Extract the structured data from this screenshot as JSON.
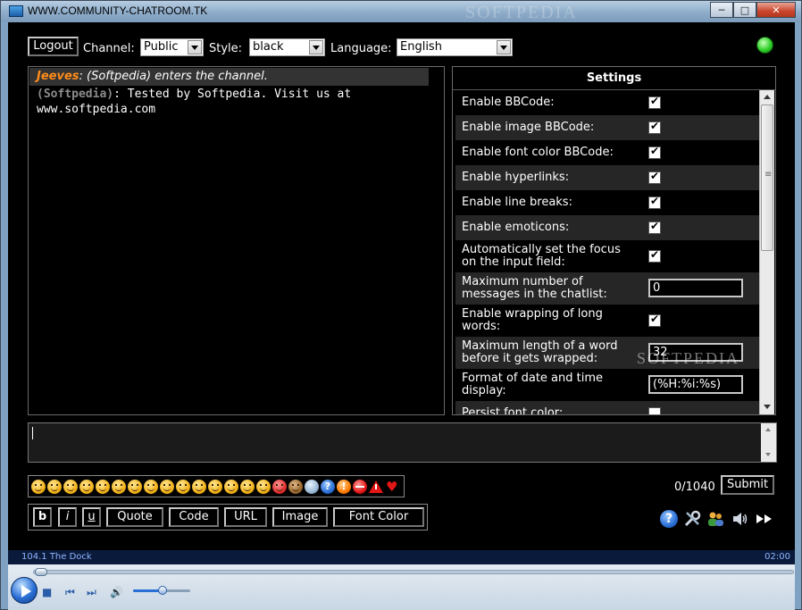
{
  "window": {
    "title": "WWW.COMMUNITY-CHATROOM.TK",
    "watermark": "SOFTPEDIA",
    "minimize": "─",
    "maximize": "□",
    "close": "✕"
  },
  "topbar": {
    "logout_label": "Logout",
    "channel_label": "Channel:",
    "channel_value": "Public",
    "style_label": "Style:",
    "style_value": "black",
    "language_label": "Language:",
    "language_value": "English",
    "status_color": "#2fd02a"
  },
  "chat": {
    "messages": [
      {
        "user": "Jeeves",
        "sep": ": ",
        "text": "(Softpedia) enters the channel."
      },
      {
        "user": "(Softpedia)",
        "sep": ": ",
        "text": "Tested by Softpedia. Visit us at www.softpedia.com"
      }
    ]
  },
  "settings": {
    "title": "Settings",
    "rows": [
      {
        "label": "Enable BBCode:",
        "type": "checkbox",
        "checked": true
      },
      {
        "label": "Enable image BBCode:",
        "type": "checkbox",
        "checked": true
      },
      {
        "label": "Enable font color BBCode:",
        "type": "checkbox",
        "checked": true
      },
      {
        "label": "Enable hyperlinks:",
        "type": "checkbox",
        "checked": true
      },
      {
        "label": "Enable line breaks:",
        "type": "checkbox",
        "checked": true
      },
      {
        "label": "Enable emoticons:",
        "type": "checkbox",
        "checked": true
      },
      {
        "label": "Automatically set the focus on the input field:",
        "type": "checkbox",
        "checked": true
      },
      {
        "label": "Maximum number of messages in the chatlist:",
        "type": "text",
        "value": "0"
      },
      {
        "label": "Enable wrapping of long words:",
        "type": "checkbox",
        "checked": true
      },
      {
        "label": "Maximum length of a word before it gets wrapped:",
        "type": "text",
        "value": "32"
      },
      {
        "label": "Format of date and time display:",
        "type": "text",
        "value": "(%H:%i:%s)"
      },
      {
        "label": "Persist font color:",
        "type": "checkbox",
        "checked": false
      }
    ],
    "watermark": "SOFTPEDIA"
  },
  "input": {
    "counter": "0/1040",
    "submit_label": "Submit"
  },
  "emoticons": [
    "smile",
    "sad",
    "wink",
    "grin",
    "laugh",
    "neutral",
    "surprised",
    "confused",
    "cool-glasses",
    "crazy",
    "sunglasses",
    "big-grin",
    "shy",
    "tongue",
    "sleepy",
    "devil",
    "monkey",
    "lightbulb",
    "question",
    "exclamation",
    "no-entry",
    "warning",
    "heart"
  ],
  "format": {
    "bold": "b",
    "italic": "i",
    "underline": "u",
    "quote": "Quote",
    "code": "Code",
    "url": "URL",
    "image": "Image",
    "font_color": "Font Color"
  },
  "tools": [
    "help-icon",
    "settings-icon",
    "online-users-icon",
    "sound-icon",
    "fast-forward-icon"
  ],
  "media": {
    "track": "104.1 The Dock",
    "time": "02:00"
  }
}
